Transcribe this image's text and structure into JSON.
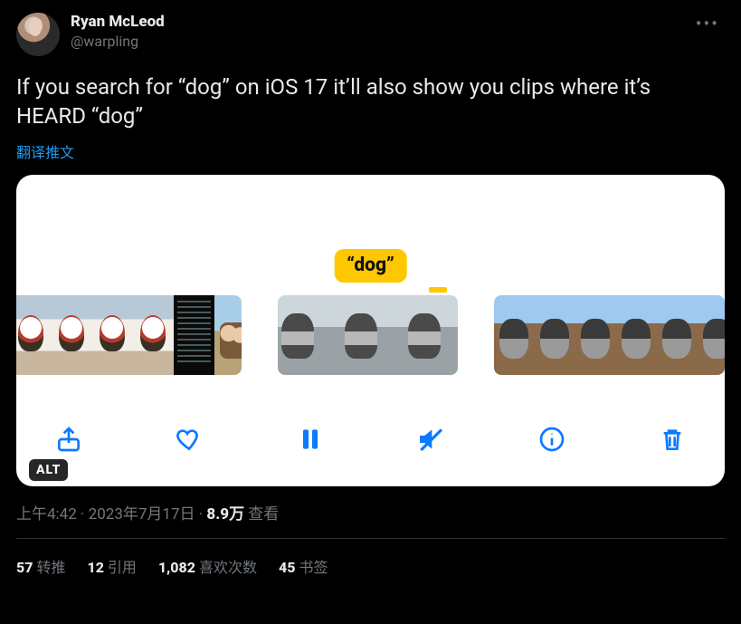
{
  "author": {
    "display_name": "Ryan McLeod",
    "handle": "@warpling"
  },
  "tweet_text": "If you search for “dog” on iOS 17 it’ll also show you clips where it’s HEARD “dog”",
  "translate_label": "翻译推文",
  "media": {
    "caption_chip": "“dog”",
    "alt_badge": "ALT",
    "toolbar_icons": [
      "share-icon",
      "heart-icon",
      "pause-icon",
      "mute-icon",
      "info-icon",
      "trash-icon"
    ]
  },
  "meta": {
    "time": "上午4:42",
    "sep1": " · ",
    "date": "2023年7月17日",
    "sep2": " · ",
    "views_value": "8.9万",
    "views_label": " 查看"
  },
  "stats": {
    "retweets": {
      "value": "57",
      "label": "转推"
    },
    "quotes": {
      "value": "12",
      "label": "引用"
    },
    "likes": {
      "value": "1,082",
      "label": "喜欢次数"
    },
    "bookmarks": {
      "value": "45",
      "label": "书签"
    }
  }
}
